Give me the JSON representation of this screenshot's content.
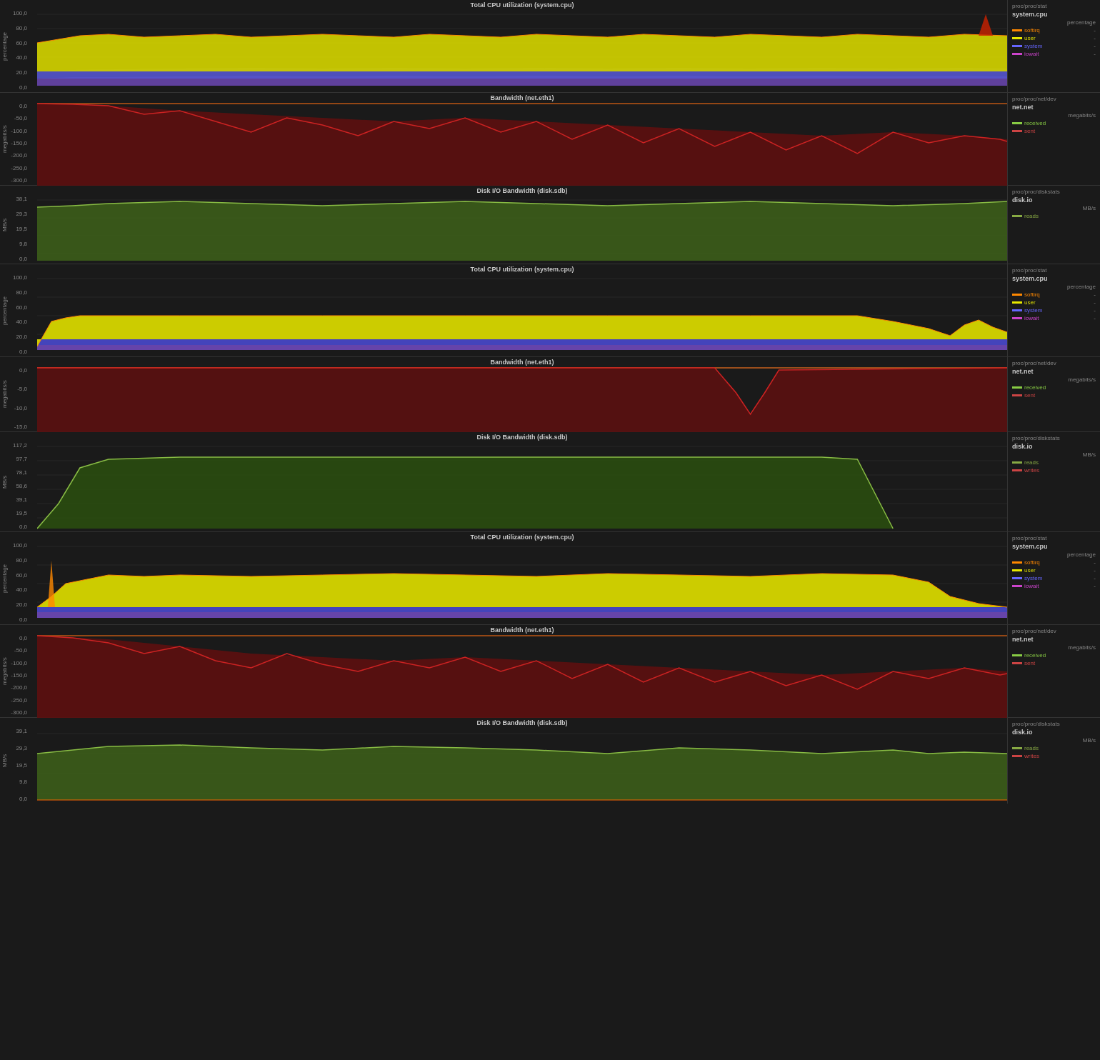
{
  "charts": [
    {
      "id": "cpu1",
      "title": "Total CPU utilization (system.cpu)",
      "sidebar_path": "proc/proc/stat",
      "sidebar_name": "system.cpu",
      "sidebar_unit": "percentage",
      "y_label": "percentage",
      "y_ticks": [
        "100,0",
        "80,0",
        "60,0",
        "40,0",
        "20,0",
        "0,0"
      ],
      "height": 120,
      "type": "cpu",
      "legend": [
        {
          "label": "softirq",
          "color": "#ff6600"
        },
        {
          "label": "user",
          "color": "#e8e800"
        },
        {
          "label": "system",
          "color": "#6666ff"
        },
        {
          "label": "iowait",
          "color": "#cc44cc"
        }
      ]
    },
    {
      "id": "net1",
      "title": "Bandwidth (net.eth1)",
      "sidebar_path": "proc/proc/net/dev",
      "sidebar_name": "net.net",
      "sidebar_unit": "megabits/s",
      "y_label": "megabits/s",
      "y_ticks": [
        "0,0",
        "-50,0",
        "-100,0",
        "-150,0",
        "-200,0",
        "-250,0",
        "-300,0"
      ],
      "height": 120,
      "type": "net1",
      "legend": [
        {
          "label": "received",
          "color": "#88cc44"
        },
        {
          "label": "sent",
          "color": "#cc4444"
        }
      ]
    },
    {
      "id": "disk1",
      "title": "Disk I/O Bandwidth (disk.sdb)",
      "sidebar_path": "proc/proc/diskstats",
      "sidebar_name": "disk.io",
      "sidebar_unit": "MB/s",
      "y_label": "MB/s",
      "y_ticks": [
        "38,1",
        "29,3",
        "19,5",
        "9,8",
        "0,0"
      ],
      "height": 110,
      "type": "disk1",
      "legend": [
        {
          "label": "reads",
          "color": "#88aa44"
        }
      ]
    },
    {
      "id": "cpu2",
      "title": "Total CPU utilization (system.cpu)",
      "sidebar_path": "proc/proc/stat",
      "sidebar_name": "system.cpu",
      "sidebar_unit": "percentage",
      "y_label": "percentage",
      "y_ticks": [
        "100,0",
        "80,0",
        "60,0",
        "40,0",
        "20,0",
        "0,0"
      ],
      "height": 120,
      "type": "cpu2",
      "legend": [
        {
          "label": "softirq",
          "color": "#ff6600"
        },
        {
          "label": "user",
          "color": "#e8e800"
        },
        {
          "label": "system",
          "color": "#6666ff"
        },
        {
          "label": "iowait",
          "color": "#cc44cc"
        }
      ]
    },
    {
      "id": "net2",
      "title": "Bandwidth (net.eth1)",
      "sidebar_path": "proc/proc/net/dev",
      "sidebar_name": "net.net",
      "sidebar_unit": "megabits/s",
      "y_label": "megabits/s",
      "y_ticks": [
        "0,0",
        "-5,0",
        "-10,0",
        "-15,0"
      ],
      "height": 100,
      "type": "net2",
      "legend": [
        {
          "label": "received",
          "color": "#88cc44"
        },
        {
          "label": "sent",
          "color": "#cc4444"
        }
      ]
    },
    {
      "id": "disk2",
      "title": "Disk I/O Bandwidth (disk.sdb)",
      "sidebar_path": "proc/proc/diskstats",
      "sidebar_name": "disk.io",
      "sidebar_unit": "MB/s",
      "y_label": "MB/s",
      "y_ticks": [
        "117,2",
        "97,7",
        "78,1",
        "58,6",
        "39,1",
        "19,5",
        "0,0"
      ],
      "height": 130,
      "type": "disk2",
      "legend": [
        {
          "label": "reads",
          "color": "#88aa44"
        },
        {
          "label": "writes",
          "color": "#cc4444"
        }
      ]
    },
    {
      "id": "cpu3",
      "title": "Total CPU utilization (system.cpu)",
      "sidebar_path": "proc/proc/stat",
      "sidebar_name": "system.cpu",
      "sidebar_unit": "percentage",
      "y_label": "percentage",
      "y_ticks": [
        "100,0",
        "80,0",
        "60,0",
        "40,0",
        "20,0",
        "0,0"
      ],
      "height": 120,
      "type": "cpu3",
      "legend": [
        {
          "label": "softirq",
          "color": "#ff6600"
        },
        {
          "label": "user",
          "color": "#e8e800"
        },
        {
          "label": "system",
          "color": "#6666ff"
        },
        {
          "label": "iowait",
          "color": "#cc44cc"
        }
      ]
    },
    {
      "id": "net3",
      "title": "Bandwidth (net.eth1)",
      "sidebar_path": "proc/proc/net/dev",
      "sidebar_name": "net.net",
      "sidebar_unit": "megabits/s",
      "y_label": "megabits/s",
      "y_ticks": [
        "0,0",
        "-50,0",
        "-100,0",
        "-150,0",
        "-200,0",
        "-250,0",
        "-300,0"
      ],
      "height": 120,
      "type": "net3",
      "legend": [
        {
          "label": "received",
          "color": "#88cc44"
        },
        {
          "label": "sent",
          "color": "#cc4444"
        }
      ]
    },
    {
      "id": "disk3",
      "title": "Disk I/O Bandwidth (disk.sdb)",
      "sidebar_path": "proc/proc/diskstats",
      "sidebar_name": "disk.io",
      "sidebar_unit": "MB/s",
      "y_label": "MB/s",
      "y_ticks": [
        "39,1",
        "29,3",
        "19,5",
        "9,8",
        "0,0"
      ],
      "height": 110,
      "type": "disk3",
      "legend": [
        {
          "label": "reads",
          "color": "#88aa44"
        },
        {
          "label": "writes",
          "color": "#cc4444"
        }
      ]
    }
  ]
}
